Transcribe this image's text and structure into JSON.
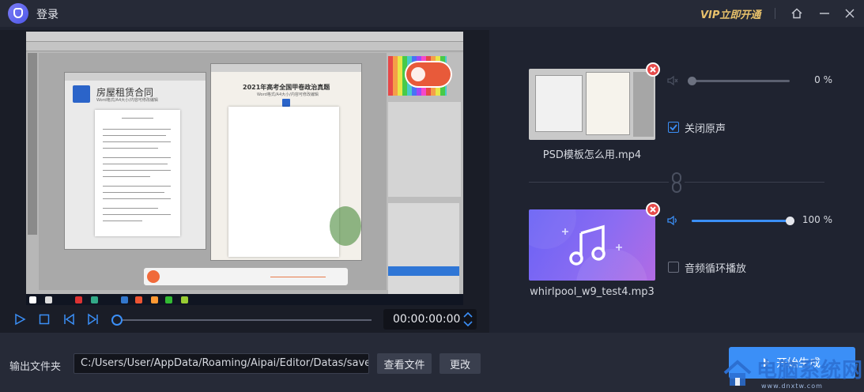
{
  "titlebar": {
    "title": "登录",
    "vip_label": "VIP立即开通",
    "home_icon": "home-icon",
    "minimize_icon": "minimize-icon",
    "close_icon": "close-icon"
  },
  "player": {
    "time": "00:00:00:00",
    "progress": 0,
    "controls": [
      "play-icon",
      "stop-icon",
      "previous-icon",
      "next-icon"
    ]
  },
  "preview_frame": {
    "doc1_title": "房屋租赁合同",
    "doc1_sub": "Word格式/A4大小/内容可修改编辑",
    "doc2_title": "2021年高考全国甲卷政治真题",
    "doc2_sub": "Word格式/A4大小/内容可修改编辑"
  },
  "video_track": {
    "filename": "PSD模板怎么用.mp4",
    "volume_percent": 0,
    "volume_label": "0 %",
    "mute_original_label": "关闭原声",
    "mute_original_checked": true
  },
  "audio_track": {
    "filename": "whirlpool_w9_test4.mp3",
    "volume_percent": 100,
    "volume_label": "100 %",
    "loop_label": "音频循环播放",
    "loop_checked": false
  },
  "output": {
    "label": "输出文件夹",
    "path": "C:/Users/User/AppData/Roaming/Aipai/Editor/Datas/save/outp",
    "view_button": "查看文件",
    "change_button": "更改",
    "start_button": "开始生成"
  },
  "watermark": {
    "text": "电脑系统网",
    "url": "www.dnxtw.com"
  },
  "colors": {
    "accent": "#3b8ff7",
    "vip": "#e8c16b",
    "delete": "#e74b4b",
    "background": "#1f2330"
  }
}
